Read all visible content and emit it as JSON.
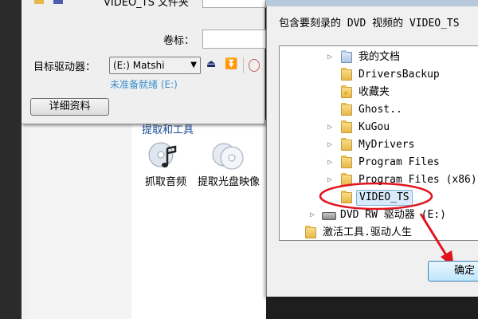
{
  "burn_window": {
    "folder_label": "VIDEO_TS 文件夹",
    "volume_label": "卷标：",
    "target_drive_label": "目标驱动器：",
    "drive_selected": "(E:) Matshi",
    "status": "未准备就绪 (E:)",
    "details_button": "详细资料"
  },
  "tools": {
    "header": "提取和工具",
    "items": [
      {
        "label": "抓取音频",
        "icon": "music-disc-icon"
      },
      {
        "label": "提取光盘映像",
        "icon": "disc-image-icon"
      }
    ]
  },
  "dialog": {
    "description": "包含要刻录的 DVD 视频的 VIDEO_TS",
    "tree": [
      {
        "label": "我的文档",
        "expandable": true
      },
      {
        "label": "DriversBackup",
        "expandable": false
      },
      {
        "label": "收藏夹",
        "expandable": false
      },
      {
        "label": "Ghost..",
        "expandable": false
      },
      {
        "label": "KuGou",
        "expandable": true
      },
      {
        "label": "MyDrivers",
        "expandable": true
      },
      {
        "label": "Program Files",
        "expandable": true
      },
      {
        "label": "Program Files (x86)",
        "expandable": true
      },
      {
        "label": "VIDEO_TS",
        "expandable": false,
        "selected": true
      },
      {
        "label": "DVD RW 驱动器 (E:)",
        "expandable": true
      },
      {
        "label": "激活工具.驱动人生",
        "expandable": false
      }
    ],
    "ok_button": "确定"
  },
  "colors": {
    "annotation": "#e0141e",
    "status_text": "#3a8fd0",
    "tools_header": "#1b4f9c"
  }
}
